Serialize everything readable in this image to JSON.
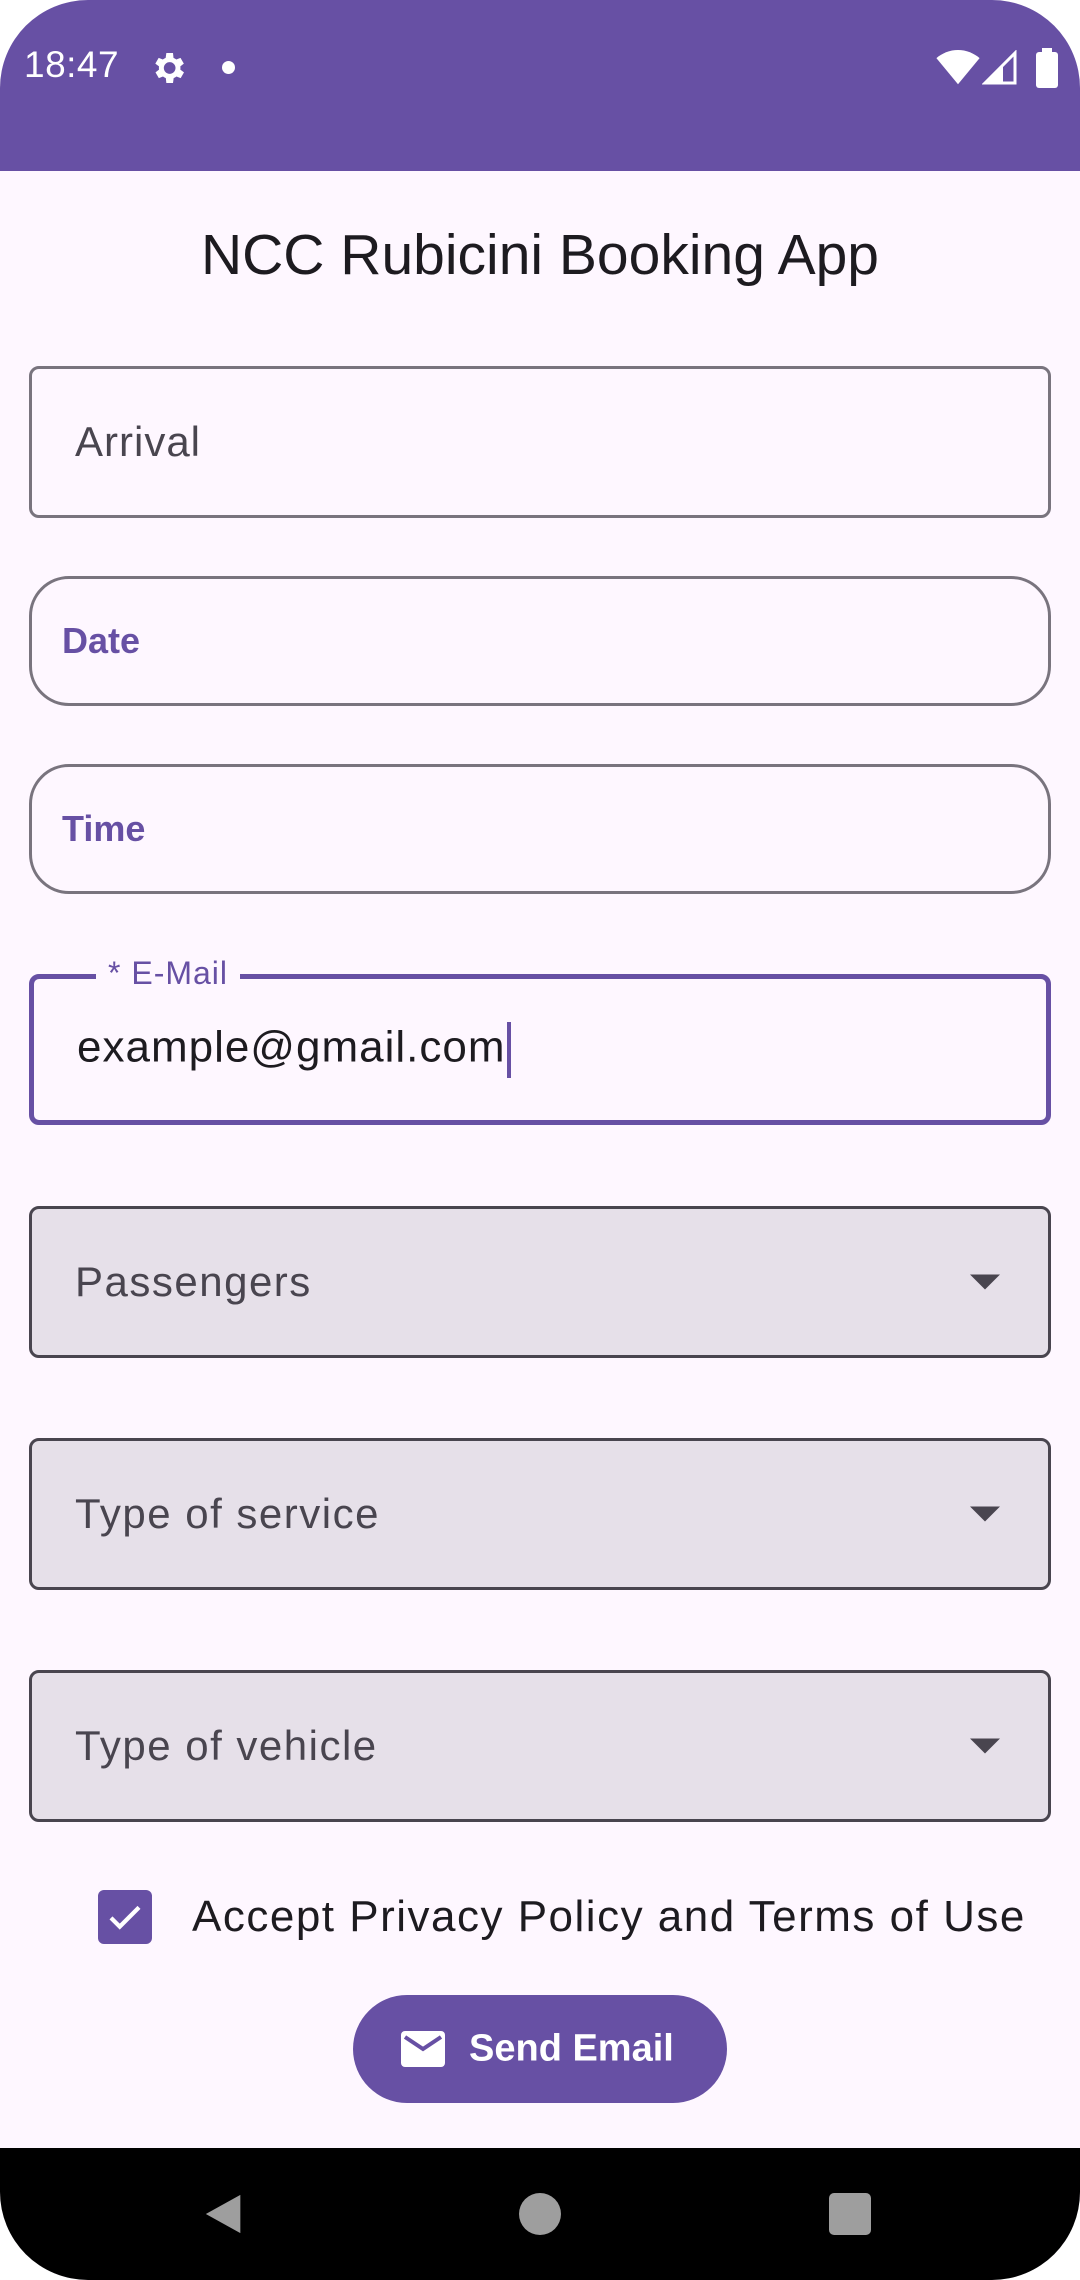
{
  "status_bar": {
    "time": "18:47",
    "icons": [
      "gear-icon",
      "notification-dot-icon",
      "wifi-icon",
      "signal-icon",
      "battery-icon"
    ]
  },
  "app": {
    "title": "NCC Rubicini Booking App"
  },
  "form": {
    "arrival": {
      "placeholder": "Arrival"
    },
    "date": {
      "label": "Date"
    },
    "time": {
      "label": "Time"
    },
    "email": {
      "label": "* E-Mail",
      "value": "example@gmail.com"
    },
    "passengers": {
      "label": "Passengers"
    },
    "service_type": {
      "label": "Type of service"
    },
    "vehicle_type": {
      "label": "Type of vehicle"
    },
    "privacy": {
      "label": "Accept Privacy Policy and Terms of Use",
      "checked": true
    }
  },
  "actions": {
    "send_label": "Send Email",
    "send_icon": "mail-icon"
  },
  "navigation": {
    "buttons": [
      "back-icon",
      "home-icon",
      "recents-icon"
    ]
  },
  "colors": {
    "primary": "#6750A4",
    "surface": "#FEF7FF",
    "dropdown_fill": "#E6E0E9",
    "outline": "#79747E"
  }
}
